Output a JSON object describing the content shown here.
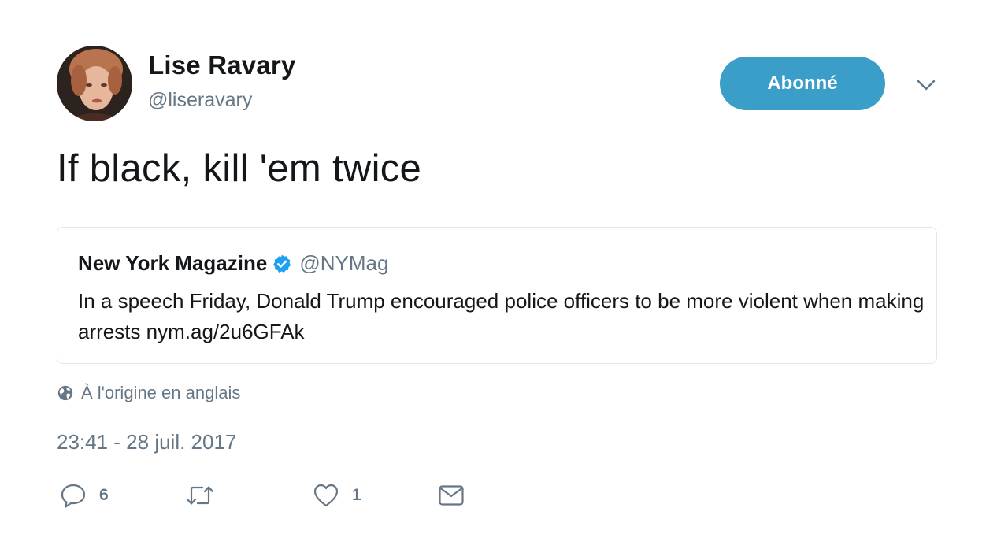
{
  "author": {
    "display_name": "Lise Ravary",
    "screen_name": "@liseravary",
    "avatar_icon": "user-avatar"
  },
  "follow_button": {
    "label": "Abonné",
    "color": "#3b9ec9"
  },
  "more_icon": "chevron-down-icon",
  "tweet": {
    "text": "If black, kill 'em twice"
  },
  "quoted_tweet": {
    "name": "New York Magazine",
    "verified_icon": "verified-badge-icon",
    "handle": "@NYMag",
    "text": "In a speech Friday, Donald Trump encouraged police officers to be more violent when making arrests nym.ag/2u6GFAk"
  },
  "translation": {
    "label": "À l'origine en anglais",
    "icon": "globe-icon"
  },
  "timestamp": "23:41 - 28 juil. 2017",
  "actions": {
    "reply": {
      "icon": "reply-icon",
      "count": "6"
    },
    "retweet": {
      "icon": "retweet-icon",
      "count": ""
    },
    "like": {
      "icon": "heart-icon",
      "count": "1"
    },
    "dm": {
      "icon": "envelope-icon"
    }
  },
  "colors": {
    "text": "#14171a",
    "secondary": "#657786",
    "verified": "#1da1f2",
    "border": "#e1e8ed"
  }
}
